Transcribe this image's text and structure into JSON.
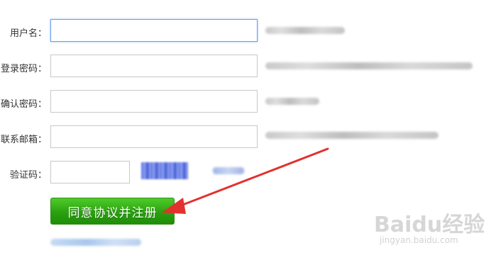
{
  "form": {
    "username": {
      "label": "用户名：",
      "value": ""
    },
    "password": {
      "label": "登录密码：",
      "value": ""
    },
    "confirm_password": {
      "label": "确认密码：",
      "value": ""
    },
    "email": {
      "label": "联系邮箱：",
      "value": ""
    },
    "captcha": {
      "label": "验证码：",
      "value": ""
    },
    "submit_label": "同意协议并注册"
  },
  "colors": {
    "submit_green": "#2aa10f",
    "arrow_red": "#e2312e",
    "focus_border": "#6aa0e8"
  },
  "watermark": {
    "brand": "Baidu经验",
    "url": "jingyan.baidu.com"
  }
}
